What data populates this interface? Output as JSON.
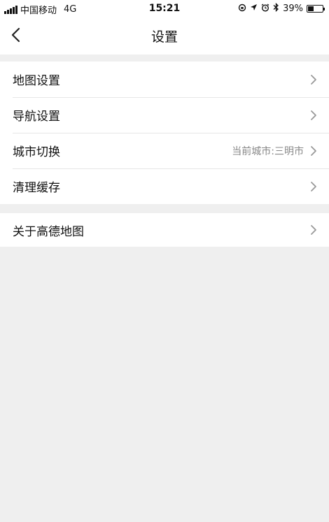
{
  "status_bar": {
    "carrier": "中国移动",
    "network": "4G",
    "time": "15:21",
    "battery_text": "39%",
    "battery_level": 0.39,
    "icons": [
      "signal-icon",
      "lock-rotation-icon",
      "location-arrow-icon",
      "alarm-icon",
      "bluetooth-icon",
      "battery-icon"
    ]
  },
  "nav": {
    "title": "设置",
    "back_icon": "chevron-left-icon"
  },
  "settings_group_1": [
    {
      "label": "地图设置",
      "value": ""
    },
    {
      "label": "导航设置",
      "value": ""
    },
    {
      "label": "城市切换",
      "value": "当前城市:三明市"
    },
    {
      "label": "清理缓存",
      "value": ""
    }
  ],
  "settings_group_2": [
    {
      "label": "关于高德地图",
      "value": ""
    }
  ],
  "colors": {
    "background": "#efefef",
    "row_background": "#ffffff",
    "secondary_text": "#888888"
  }
}
